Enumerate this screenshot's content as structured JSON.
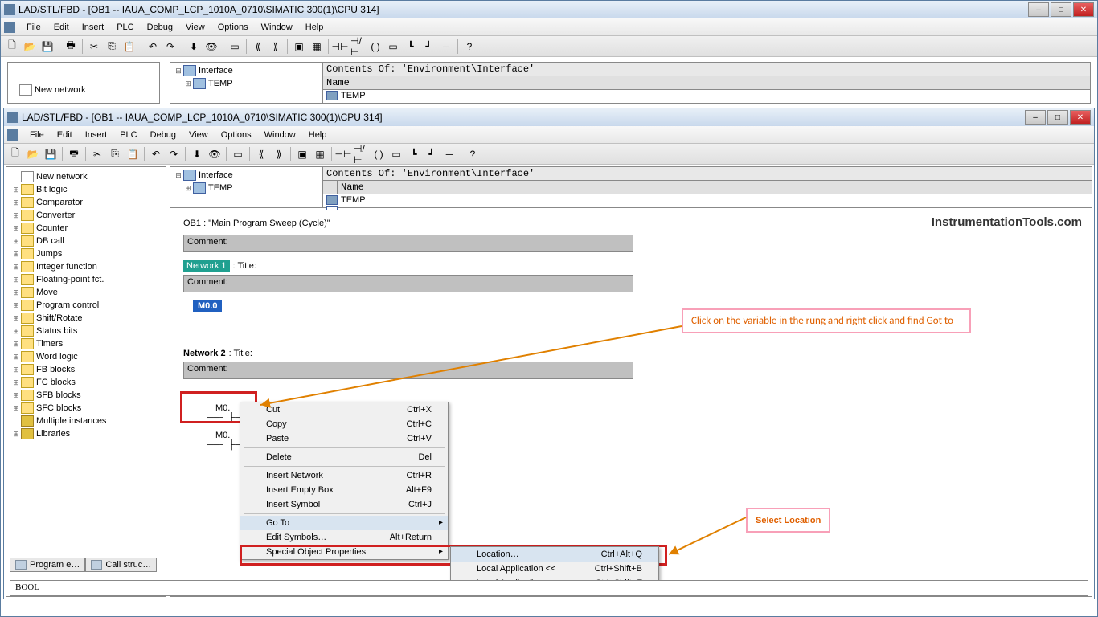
{
  "windows": {
    "outer": {
      "title": "LAD/STL/FBD  - [OB1 -- IAUA_COMP_LCP_1010A_0710\\SIMATIC 300(1)\\CPU 314]"
    },
    "inner": {
      "title": "LAD/STL/FBD  - [OB1 -- IAUA_COMP_LCP_1010A_0710\\SIMATIC 300(1)\\CPU 314]"
    }
  },
  "menubar": [
    "File",
    "Edit",
    "Insert",
    "PLC",
    "Debug",
    "View",
    "Options",
    "Window",
    "Help"
  ],
  "sidebar_outer": {
    "item": "New network"
  },
  "sidebar": {
    "items": [
      "New network",
      "Bit logic",
      "Comparator",
      "Converter",
      "Counter",
      "DB call",
      "Jumps",
      "Integer function",
      "Floating-point fct.",
      "Move",
      "Program control",
      "Shift/Rotate",
      "Status bits",
      "Timers",
      "Word logic",
      "FB blocks",
      "FC blocks",
      "SFB blocks",
      "SFC blocks",
      "Multiple instances",
      "Libraries"
    ]
  },
  "interface": {
    "contents_label": "Contents Of: 'Environment\\Interface'",
    "root": "Interface",
    "temp": "TEMP",
    "col_name": "Name",
    "row_temp": "TEMP"
  },
  "editor": {
    "ob_label": "OB1 :  \"Main Program Sweep (Cycle)\"",
    "comment": "Comment:",
    "network1": "Network 1",
    "title": ": Title:",
    "network2": "Network 2",
    "var": "M0.0",
    "var2": "M0.",
    "var3": "M0."
  },
  "context": {
    "items": [
      {
        "label": "Cut",
        "shortcut": "Ctrl+X"
      },
      {
        "label": "Copy",
        "shortcut": "Ctrl+C"
      },
      {
        "label": "Paste",
        "shortcut": "Ctrl+V"
      },
      {
        "sep": true
      },
      {
        "label": "Delete",
        "shortcut": "Del"
      },
      {
        "sep": true
      },
      {
        "label": "Insert Network",
        "shortcut": "Ctrl+R"
      },
      {
        "label": "Insert Empty Box",
        "shortcut": "Alt+F9"
      },
      {
        "label": "Insert Symbol",
        "shortcut": "Ctrl+J"
      },
      {
        "sep": true
      },
      {
        "label": "Go To",
        "shortcut": "",
        "sub": true,
        "highlight": true
      },
      {
        "label": "Edit Symbols…",
        "shortcut": "Alt+Return"
      },
      {
        "label": "Special Object Properties",
        "shortcut": "",
        "sub": true
      }
    ],
    "submenu": [
      {
        "label": "Location…",
        "shortcut": "Ctrl+Alt+Q",
        "highlight": true
      },
      {
        "label": "Local Application <<",
        "shortcut": "Ctrl+Shift+B"
      },
      {
        "label": "Local Application >>",
        "shortcut": "Ctrl+Shift+F"
      }
    ]
  },
  "callouts": {
    "find_goto": "Click on the variable in the rung and right click and find Got to",
    "select_location": "Select Location"
  },
  "status_tabs": {
    "prog": "Program e…",
    "call": "Call struc…"
  },
  "bool_bar": "BOOL",
  "watermark": "InstrumentationTools.com"
}
